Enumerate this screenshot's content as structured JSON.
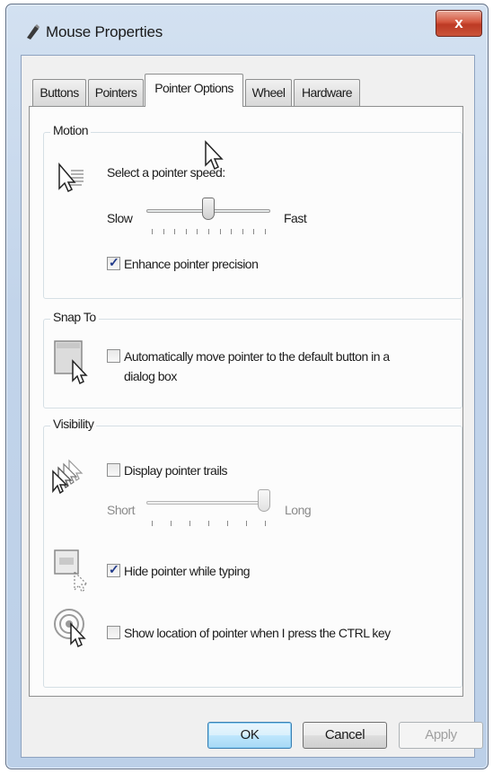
{
  "window": {
    "title": "Mouse Properties",
    "close_label": "x"
  },
  "tabs": [
    {
      "label": "Buttons",
      "active": false
    },
    {
      "label": "Pointers",
      "active": false
    },
    {
      "label": "Pointer Options",
      "active": true
    },
    {
      "label": "Wheel",
      "active": false
    },
    {
      "label": "Hardware",
      "active": false
    }
  ],
  "motion": {
    "group_title": "Motion",
    "prompt": "Select a pointer speed:",
    "slow_label": "Slow",
    "fast_label": "Fast",
    "speed_level": 0.5,
    "enhance_precision_label": "Enhance pointer precision",
    "enhance_precision_checked": true
  },
  "snap_to": {
    "group_title": "Snap To",
    "auto_move_label_line1": "Automatically move pointer to the default button in a",
    "auto_move_label_line2": "dialog box",
    "auto_move_checked": false
  },
  "visibility": {
    "group_title": "Visibility",
    "trails_label": "Display pointer trails",
    "trails_checked": false,
    "short_label": "Short",
    "long_label": "Long",
    "trail_length_level": 1.0,
    "hide_while_typing_label": "Hide pointer while typing",
    "hide_while_typing_checked": true,
    "show_location_label": "Show location of pointer when I press the CTRL key",
    "show_location_checked": false
  },
  "buttons": {
    "ok": "OK",
    "cancel": "Cancel",
    "apply": "Apply"
  },
  "colors": {
    "title_bar": "#c2d4ea",
    "close_button": "#c9432c",
    "default_button": "#bee6fd",
    "check_mark": "#20398a"
  }
}
